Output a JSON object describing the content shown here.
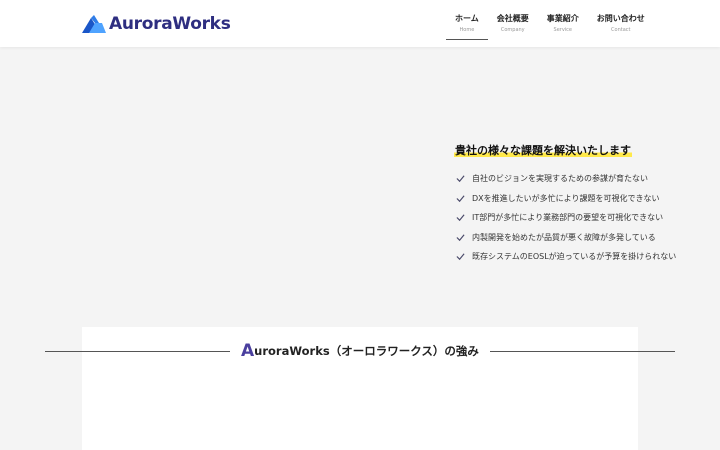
{
  "header": {
    "logo_text": "AuroraWorks",
    "brand_color": "#2e2e80",
    "logo_mark_colors": [
      "#1a56c8",
      "#4fa3ff"
    ],
    "nav": [
      {
        "label": "ホーム",
        "sub": "Home",
        "active": true
      },
      {
        "label": "会社概要",
        "sub": "Company"
      },
      {
        "label": "事業紹介",
        "sub": "Service"
      },
      {
        "label": "お問い合わせ",
        "sub": "Contact"
      }
    ]
  },
  "issues": {
    "title": "貴社の様々な課題を解決いたします",
    "highlight_color": "#ffe94a",
    "check_icon": "check-icon",
    "items": [
      "自社のビジョンを実現するための参謀が育たない",
      "DXを推進したいが多忙により課題を可視化できない",
      "IT部門が多忙により業務部門の要望を可視化できない",
      "内製開発を始めたが品質が悪く故障が多発している",
      "既存システムのEOSLが迫っているが予算を掛けられない"
    ]
  },
  "strengths": {
    "initial": "A",
    "title_rest": "uroraWorks（オーロラワークス）の強み",
    "initial_color": "#4a3f9e"
  }
}
